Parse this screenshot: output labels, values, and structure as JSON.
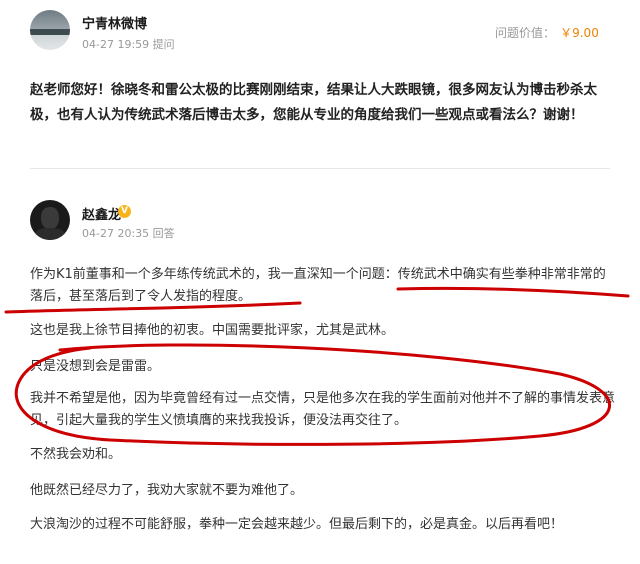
{
  "question": {
    "asker_name": "宁青林微博",
    "asked_time": "04-27 19:59",
    "asked_action": "提问",
    "price_label": "问题价值：",
    "price_value": "￥9.00",
    "text": "赵老师您好！徐晓冬和雷公太极的比赛刚刚结束，结果让人大跌眼镜，很多网友认为博击秒杀太极，也有人认为传统武术落后博击太多，您能从专业的角度给我们一些观点或看法么？谢谢！"
  },
  "answer": {
    "answerer_name": "赵鑫龙",
    "verified_badge": "V",
    "answered_time": "04-27 20:35",
    "answered_action": "回答",
    "paragraphs": [
      "作为K1前董事和一个多年练传统武术的，我一直深知一个问题：传统武术中确实有些拳种非常非常的落后，甚至落后到了令人发指的程度。",
      "这也是我上徐节目捧他的初衷。中国需要批评家，尤其是武林。",
      "只是没想到会是雷雷。",
      "我并不希望是他，因为毕竟曾经有过一点交情，只是他多次在我的学生面前对他并不了解的事情发表意见，引起大量我的学生义愤填膺的来找我投诉，便没法再交往了。",
      "不然我会劝和。",
      "他既然已经尽力了，我劝大家就不要为难他了。",
      "大浪淘沙的过程不可能舒服，拳种一定会越来越少。但最后剩下的，必是真金。以后再看吧！"
    ]
  },
  "colors": {
    "price": "#f28100",
    "annotation": "#cc0000",
    "badge": "#f8b41a"
  },
  "icons": [
    "verified-v-icon"
  ]
}
